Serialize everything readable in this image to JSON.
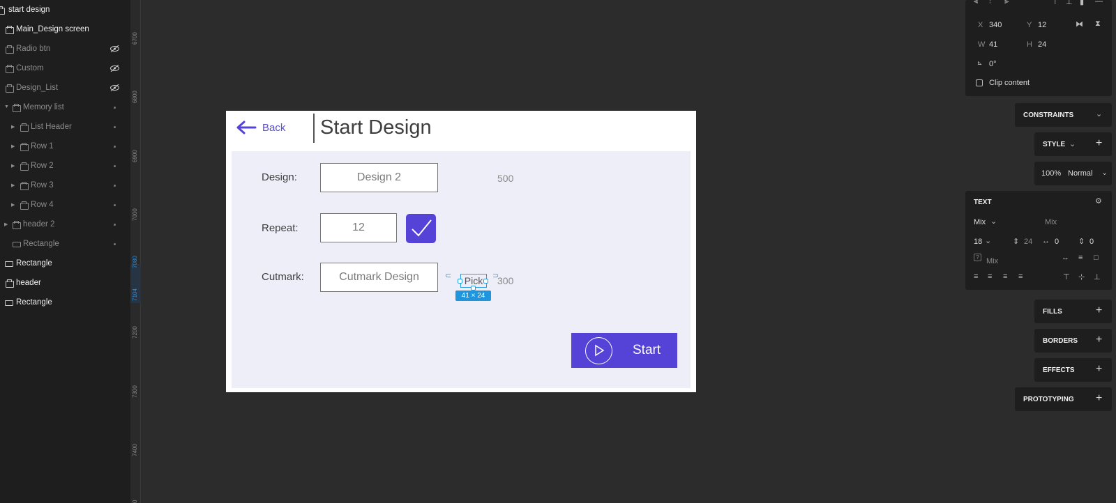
{
  "layers": {
    "items": [
      {
        "label": "start design",
        "style": "bold",
        "icon": "folder-icon"
      },
      {
        "label": "Main_Design screen",
        "style": "bold",
        "icon": "folder-icon"
      },
      {
        "label": "Radio btn",
        "style": "dim",
        "icon": "folder-icon",
        "hidden": true
      },
      {
        "label": "Custom",
        "style": "dim",
        "icon": "folder-icon",
        "hidden": true
      },
      {
        "label": "Design_List",
        "style": "dim",
        "icon": "folder-icon",
        "hidden": true
      },
      {
        "label": "Memory list",
        "style": "dim",
        "icon": "folder-icon",
        "expanded": true
      },
      {
        "label": "List Header",
        "style": "dim",
        "icon": "folder-icon"
      },
      {
        "label": "Row 1",
        "style": "dim",
        "icon": "folder-icon"
      },
      {
        "label": "Row 2",
        "style": "dim",
        "icon": "folder-icon"
      },
      {
        "label": "Row 3",
        "style": "dim",
        "icon": "folder-icon"
      },
      {
        "label": "Row 4",
        "style": "dim",
        "icon": "folder-icon"
      },
      {
        "label": "header 2",
        "style": "dim",
        "icon": "folder-icon"
      },
      {
        "label": "Rectangle",
        "style": "dim",
        "icon": "rectangle-icon"
      },
      {
        "label": "Rectangle",
        "style": "bold",
        "icon": "rectangle-icon"
      },
      {
        "label": "header",
        "style": "bold",
        "icon": "folder-icon"
      },
      {
        "label": "Rectangle",
        "style": "bold",
        "icon": "rectangle-icon"
      }
    ]
  },
  "ruler": {
    "labels": [
      "6700",
      "6800",
      "6900",
      "7000",
      "7080",
      "7104",
      "7200",
      "7300",
      "7400",
      "0"
    ]
  },
  "frame": {
    "back_label": "Back",
    "title": "Start Design",
    "design_label": "Design:",
    "design_value": "Design 2",
    "design_side_value": "500",
    "repeat_label": "Repeat:",
    "repeat_value": "12",
    "cutmark_label": "Cutmark:",
    "cutmark_value": "Cutmark Design",
    "pick_label": "Pick",
    "pick_side_value": "300",
    "selection_size": "41 × 24",
    "start_label": "Start"
  },
  "inspector": {
    "x_label": "X",
    "x_value": "340",
    "y_label": "Y",
    "y_value": "12",
    "w_label": "W",
    "w_value": "41",
    "h_label": "H",
    "h_value": "24",
    "rotation": "0°",
    "clip_content": "Clip content",
    "constraints": "CONSTRAINTS",
    "style": "STYLE",
    "opacity": "100%",
    "blend": "Normal",
    "text_section": "TEXT",
    "font_family": "Mix",
    "font_weight": "Mix",
    "font_size": "18",
    "line_height": "24",
    "letter_spacing": "0",
    "paragraph_spacing": "0",
    "text_case": "Mix",
    "fills": "FILLS",
    "borders": "BORDERS",
    "effects": "EFFECTS",
    "prototyping": "PROTOTYPING"
  },
  "colors": {
    "accent": "#5443d6",
    "selection": "#28a0e0",
    "canvas": "#2c2c2c",
    "panel": "#1e1e1e"
  }
}
